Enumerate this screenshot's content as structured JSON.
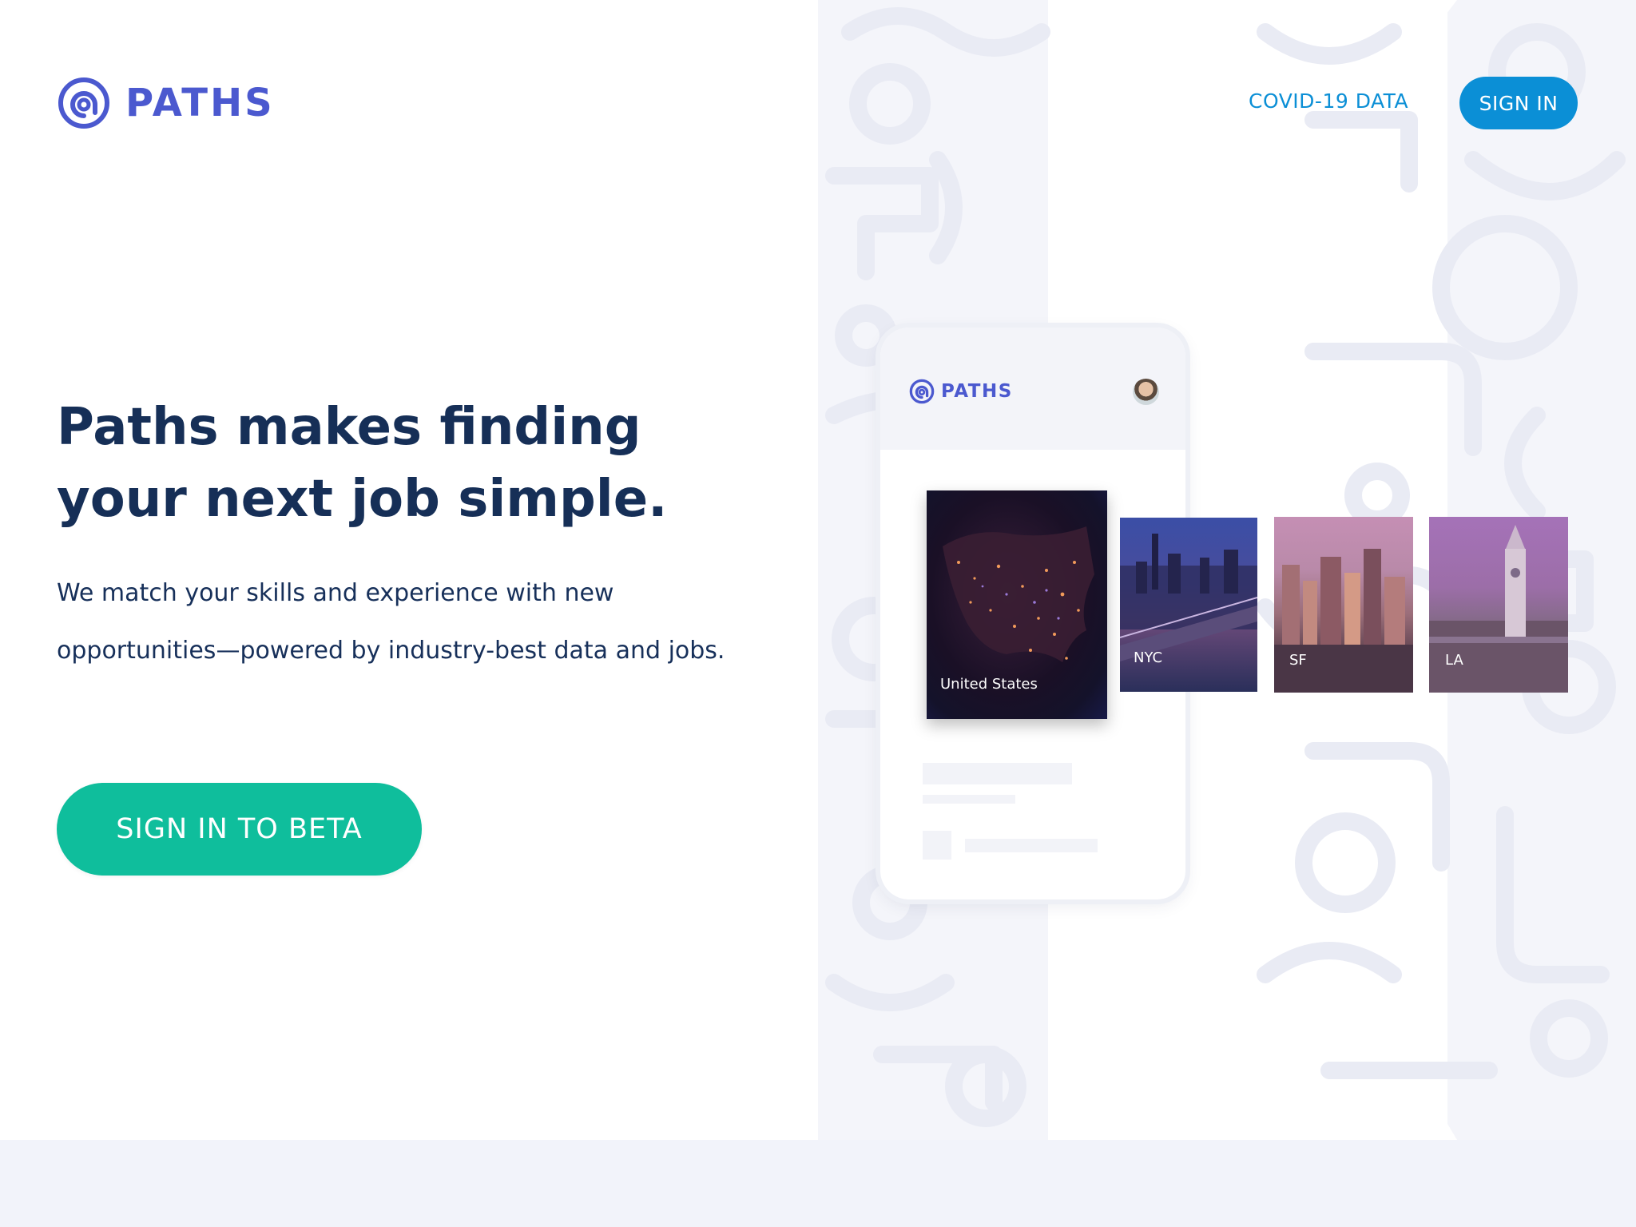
{
  "brand": {
    "name": "PATHS",
    "color": "#4b59cf"
  },
  "nav": {
    "covid_link": "COVID-19 DATA",
    "sign_in": "SIGN IN"
  },
  "hero": {
    "title": "Paths makes finding your next job simple.",
    "subtitle": "We match your skills and experience with new opportunities—powered by industry-best data and jobs.",
    "cta": "SIGN IN TO BETA"
  },
  "phone": {
    "brand": "PATHS",
    "cards": [
      {
        "label": "United States"
      },
      {
        "label": "NYC"
      },
      {
        "label": "SF"
      },
      {
        "label": "LA"
      }
    ]
  },
  "colors": {
    "accent_blue": "#0b8fd6",
    "cta_green": "#0fbe9c",
    "title_navy": "#162f57"
  },
  "icons": {
    "logo": "paths-logo-icon",
    "avatar": "avatar"
  }
}
